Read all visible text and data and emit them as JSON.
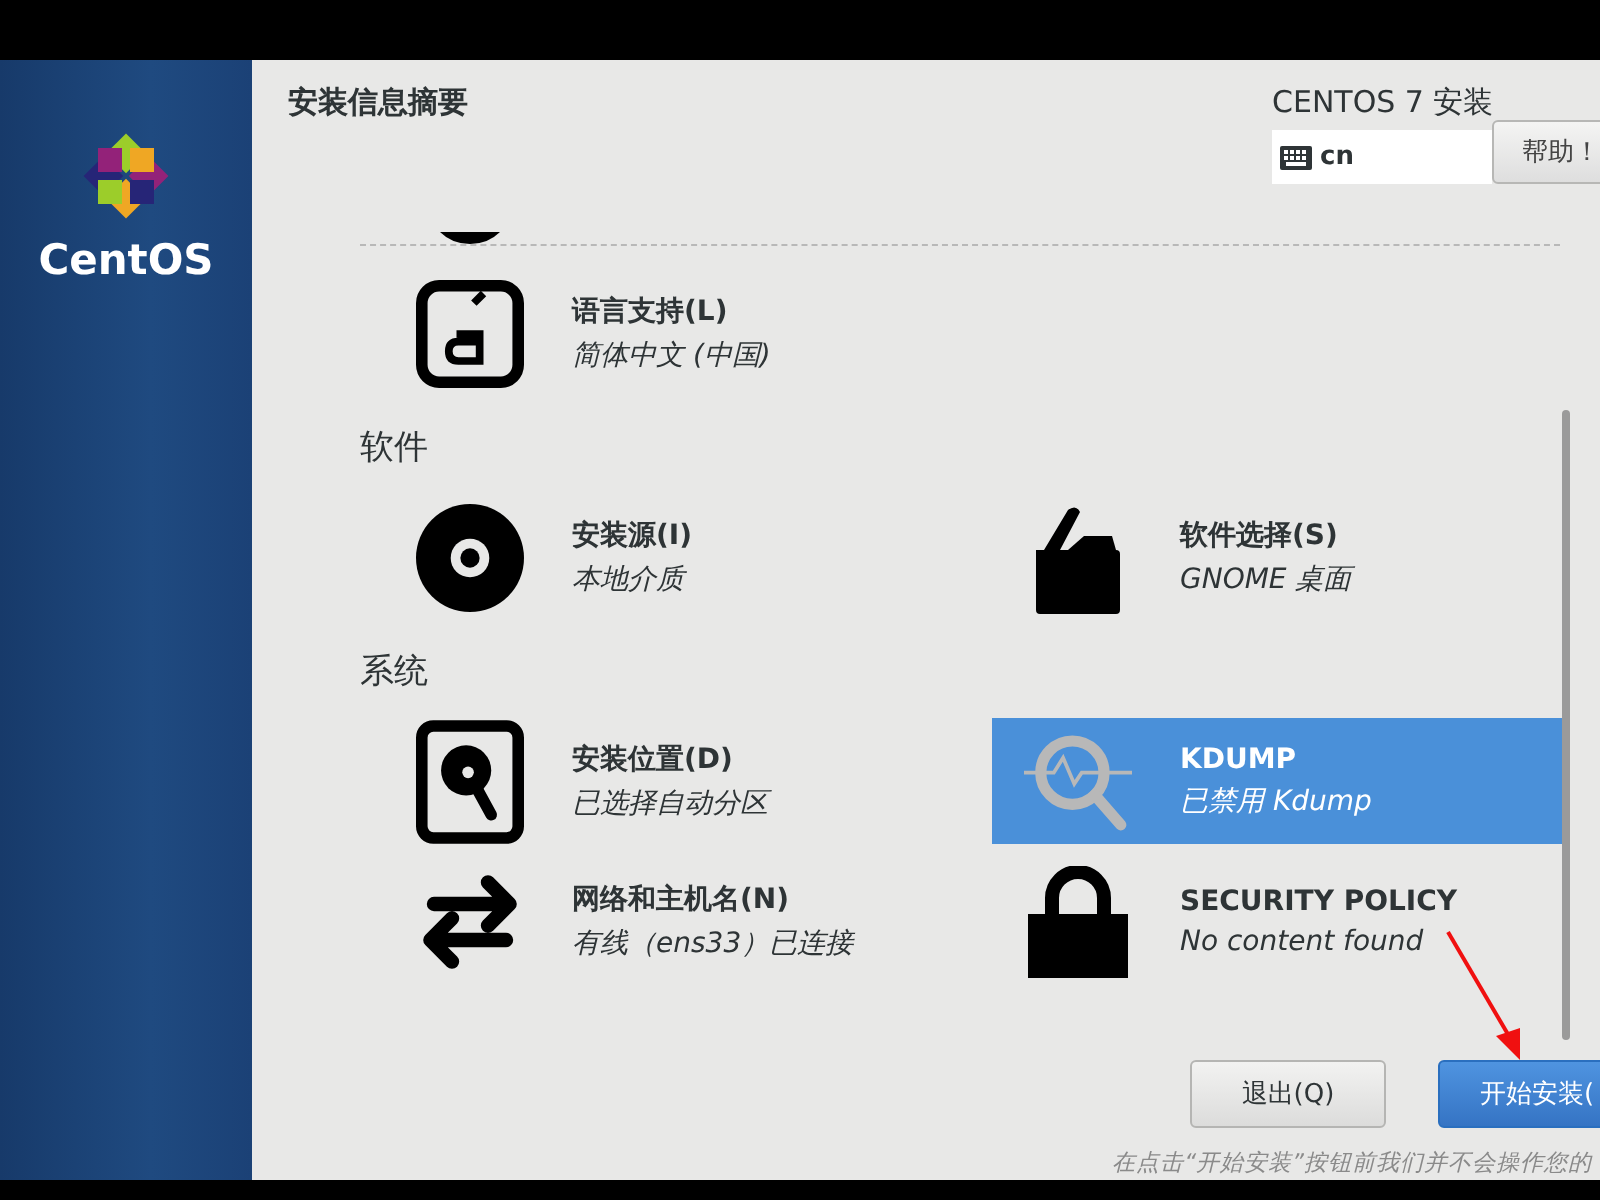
{
  "sidebar": {
    "brand": "CentOS"
  },
  "header": {
    "title": "安装信息摘要",
    "product": "CENTOS 7 安装",
    "keyboard": {
      "value": "cn"
    },
    "help_button": "帮助！"
  },
  "sections": [
    {
      "items": [
        {
          "kind": "language",
          "title": "语言支持(L)",
          "status": "简体中文 (中国)",
          "selected": false
        }
      ]
    },
    {
      "heading": "软件",
      "items": [
        {
          "kind": "source",
          "title": "安装源(I)",
          "status": "本地介质",
          "selected": false
        },
        {
          "kind": "software",
          "title": "软件选择(S)",
          "status": "GNOME 桌面",
          "selected": false
        }
      ]
    },
    {
      "heading": "系统",
      "items": [
        {
          "kind": "destination",
          "title": "安装位置(D)",
          "status": "已选择自动分区",
          "selected": false
        },
        {
          "kind": "kdump",
          "title": "KDUMP",
          "status": "已禁用 Kdump",
          "selected": true
        },
        {
          "kind": "network",
          "title": "网络和主机名(N)",
          "status": "有线（ens33）已连接",
          "selected": false
        },
        {
          "kind": "security",
          "title": "SECURITY POLICY",
          "status": "No content found",
          "selected": false
        }
      ]
    }
  ],
  "buttons": {
    "quit": "退出(Q)",
    "begin": "开始安装("
  },
  "footer_note": "在点击“开始安装”按钮前我们并不会操作您的"
}
